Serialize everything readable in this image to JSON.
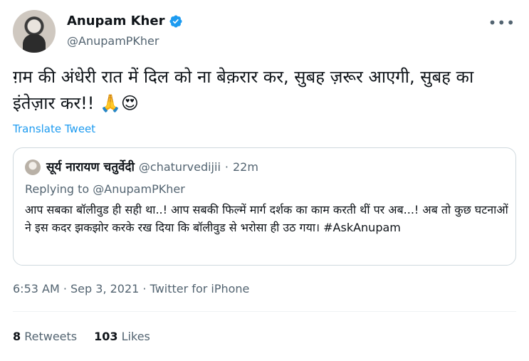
{
  "author": {
    "display_name": "Anupam Kher",
    "handle": "@AnupamPKher",
    "verified_icon": "verified-badge-icon",
    "more_label": "•••"
  },
  "tweet": {
    "text": "ग़म की अंधेरी रात में दिल को ना बेक़रार कर, सुबह ज़रूर आएगी, सुबह का इंतेज़ार कर!! 🙏😍",
    "translate_label": "Translate Tweet"
  },
  "quoted": {
    "name": "सूर्य नारायण चतुर्वेदी",
    "handle": "@chaturvedijii",
    "separator": "·",
    "time": "22m",
    "replying_to": "Replying to @AnupamPKher",
    "body": "आप सबका बॉलीवुड ही सही था..! आप सबकी फिल्में मार्ग दर्शक का काम करती थीं पर अब...! अब तो कुछ घटनाओं ने इस कदर झकझोर करके रख दिया कि बॉलीवुड से भरोसा ही उठ गया। #AskAnupam"
  },
  "meta": {
    "timestamp": "6:53 AM · Sep 3, 2021 · Twitter for iPhone"
  },
  "stats": {
    "retweets_count": "8",
    "retweets_label": "Retweets",
    "likes_count": "103",
    "likes_label": "Likes"
  },
  "colors": {
    "link": "#1d9bf0",
    "muted": "#536471",
    "text": "#0f1419",
    "border": "#cfd9de"
  }
}
